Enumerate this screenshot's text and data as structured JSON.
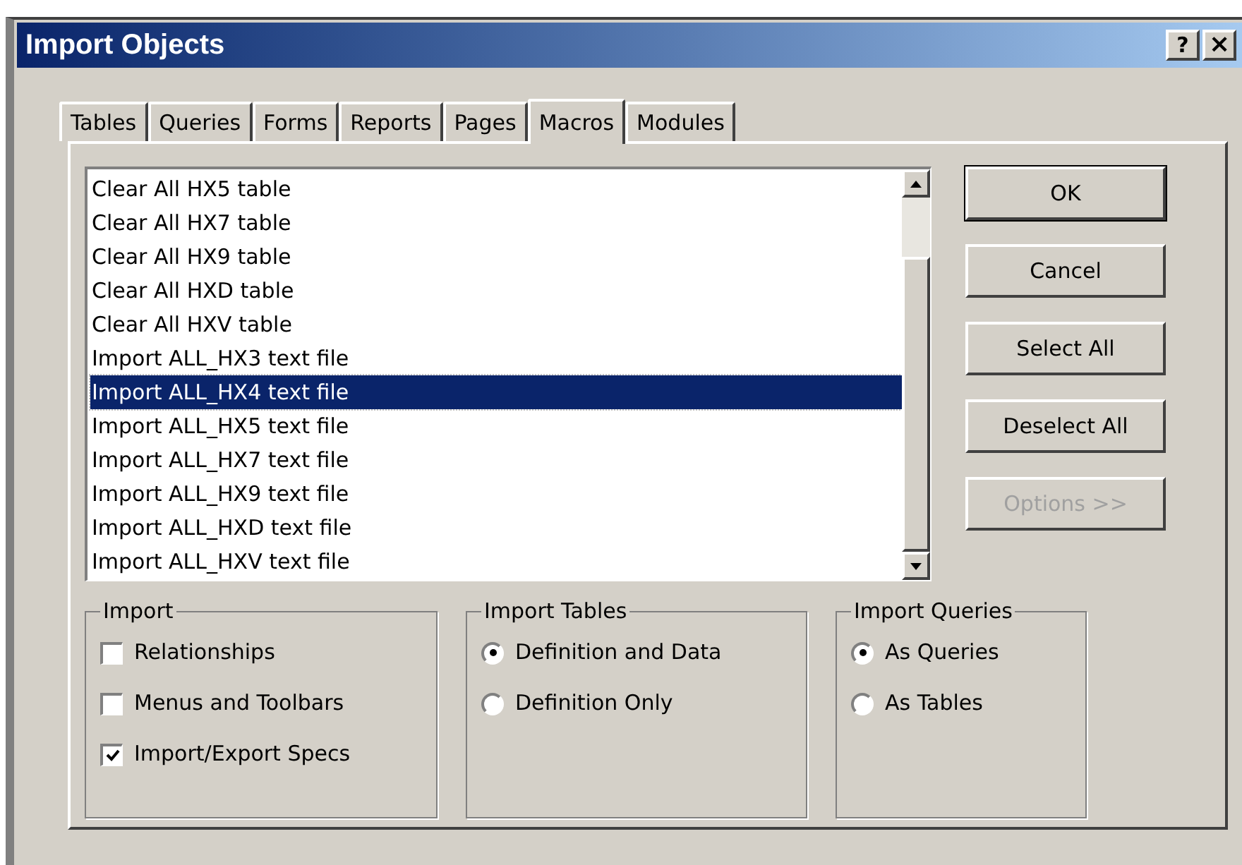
{
  "window": {
    "title": "Import Objects",
    "help_button": "?",
    "close_button": "×"
  },
  "tabs": [
    {
      "label": "Tables",
      "selected": false
    },
    {
      "label": "Queries",
      "selected": false
    },
    {
      "label": "Forms",
      "selected": false
    },
    {
      "label": "Reports",
      "selected": false
    },
    {
      "label": "Pages",
      "selected": false
    },
    {
      "label": "Macros",
      "selected": true
    },
    {
      "label": "Modules",
      "selected": false
    }
  ],
  "objects": [
    {
      "label": "Clear All HX5 table",
      "selected": false
    },
    {
      "label": "Clear All HX7 table",
      "selected": false
    },
    {
      "label": "Clear All HX9 table",
      "selected": false
    },
    {
      "label": "Clear All HXD table",
      "selected": false
    },
    {
      "label": "Clear All HXV table",
      "selected": false
    },
    {
      "label": "Import ALL_HX3 text file",
      "selected": false
    },
    {
      "label": "Import ALL_HX4 text file",
      "selected": true
    },
    {
      "label": "Import ALL_HX5 text file",
      "selected": false
    },
    {
      "label": "Import ALL_HX7 text file",
      "selected": false
    },
    {
      "label": "Import ALL_HX9 text file",
      "selected": false
    },
    {
      "label": "Import ALL_HXD text file",
      "selected": false
    },
    {
      "label": "Import ALL_HXV text file",
      "selected": false
    }
  ],
  "buttons": [
    {
      "label": "OK",
      "disabled": false,
      "default": true
    },
    {
      "label": "Cancel",
      "disabled": false,
      "default": false
    },
    {
      "label": "Select All",
      "disabled": false,
      "default": false
    },
    {
      "label": "Deselect All",
      "disabled": false,
      "default": false
    },
    {
      "label": "Options >>",
      "disabled": true,
      "default": false
    }
  ],
  "groups": [
    {
      "title": "Import",
      "kind": "checkbox",
      "options": [
        {
          "label": "Relationships",
          "checked": false
        },
        {
          "label": "Menus and Toolbars",
          "checked": false
        },
        {
          "label": "Import/Export Specs",
          "checked": true
        }
      ]
    },
    {
      "title": "Import Tables",
      "kind": "radio",
      "options": [
        {
          "label": "Definition and Data",
          "selected": true
        },
        {
          "label": "Definition Only",
          "selected": false
        }
      ]
    },
    {
      "title": "Import Queries",
      "kind": "radio",
      "options": [
        {
          "label": "As Queries",
          "selected": true
        },
        {
          "label": "As Tables",
          "selected": false
        }
      ]
    }
  ]
}
